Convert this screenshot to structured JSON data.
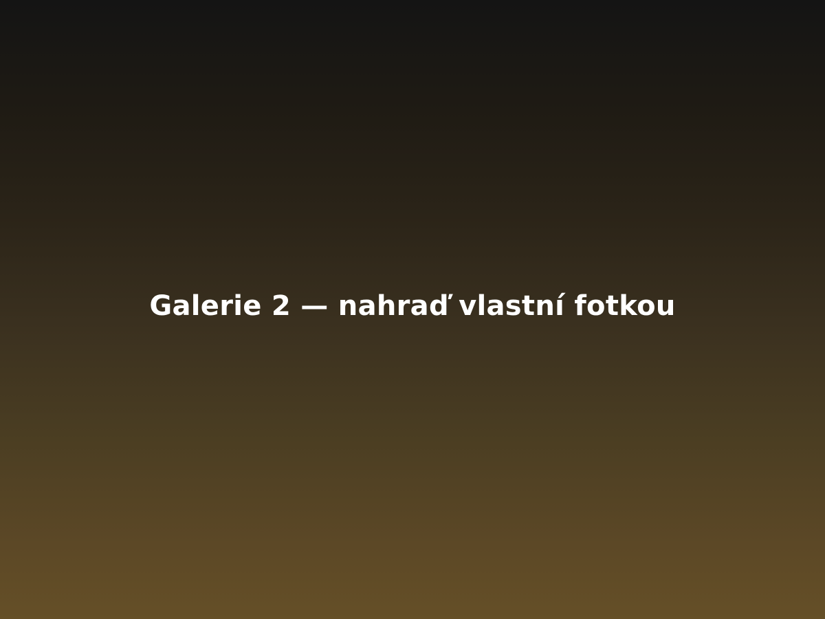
{
  "gallery_placeholder": {
    "caption": "Galerie 2 — nahraď vlastní fotkou"
  },
  "colors": {
    "gradient_top": "#141414",
    "gradient_bottom": "#654f27",
    "caption_text": "#ffffff"
  }
}
